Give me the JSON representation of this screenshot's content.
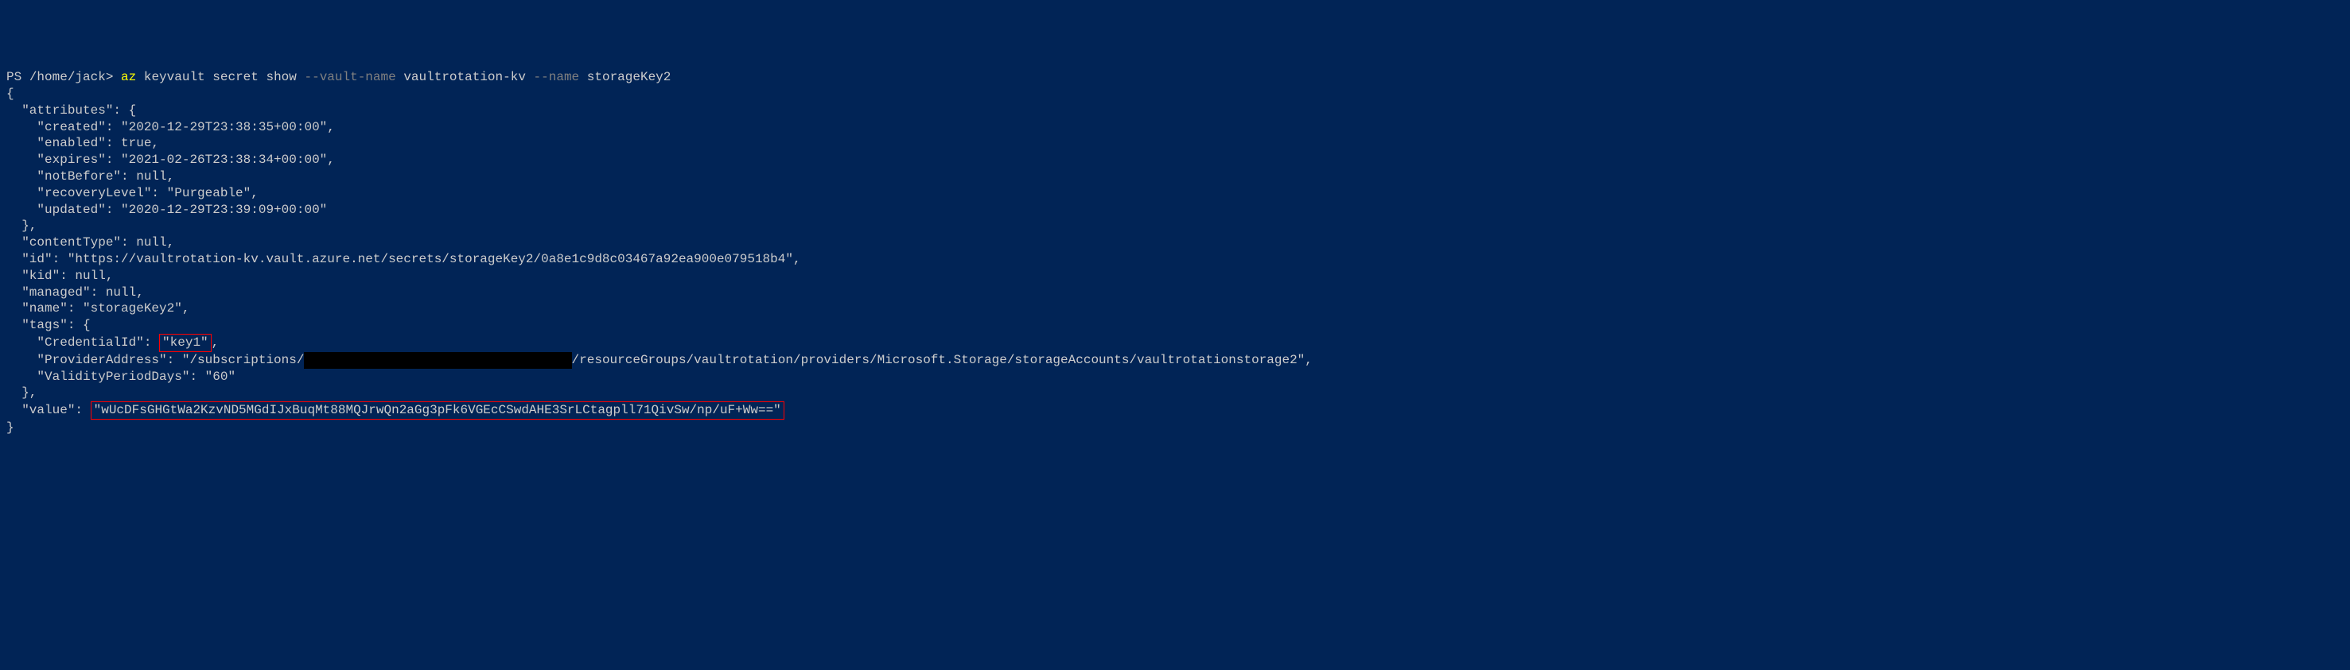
{
  "prompt": {
    "ps": "PS ",
    "path": "/home/jack",
    "sep": "> ",
    "cmd": "az ",
    "args1": "keyvault secret show ",
    "flag1": "--vault-name ",
    "val1": "vaultrotation-kv ",
    "flag2": "--name ",
    "val2": "storageKey2"
  },
  "output": {
    "l1": "{",
    "l2": "  \"attributes\": {",
    "l3": "    \"created\": \"2020-12-29T23:38:35+00:00\",",
    "l4": "    \"enabled\": true,",
    "l5": "    \"expires\": \"2021-02-26T23:38:34+00:00\",",
    "l6": "    \"notBefore\": null,",
    "l7": "    \"recoveryLevel\": \"Purgeable\",",
    "l8": "    \"updated\": \"2020-12-29T23:39:09+00:00\"",
    "l9": "  },",
    "l10": "  \"contentType\": null,",
    "l11": "  \"id\": \"https://vaultrotation-kv.vault.azure.net/secrets/storageKey2/0a8e1c9d8c03467a92ea900e079518b4\",",
    "l12": "  \"kid\": null,",
    "l13": "  \"managed\": null,",
    "l14": "  \"name\": \"storageKey2\",",
    "l15": "  \"tags\": {",
    "l16a": "    \"CredentialId\": ",
    "l16b": "\"key1\"",
    "l16c": ",",
    "l17a": "    \"ProviderAddress\": \"/subscriptions/",
    "l17black": "                                   ",
    "l17b": "/resourceGroups/vaultrotation/providers/Microsoft.Storage/storageAccounts/vaultrotationstorage2\",",
    "l18": "    \"ValidityPeriodDays\": \"60\"",
    "l19": "  },",
    "l20a": "  \"value\": ",
    "l20b": "\"wUcDFsGHGtWa2KzvND5MGdIJxBuqMt88MQJrwQn2aGg3pFk6VGEcCSwdAHE3SrLCtagpll71QivSw/np/uF+Ww==\"",
    "l21": "}"
  }
}
